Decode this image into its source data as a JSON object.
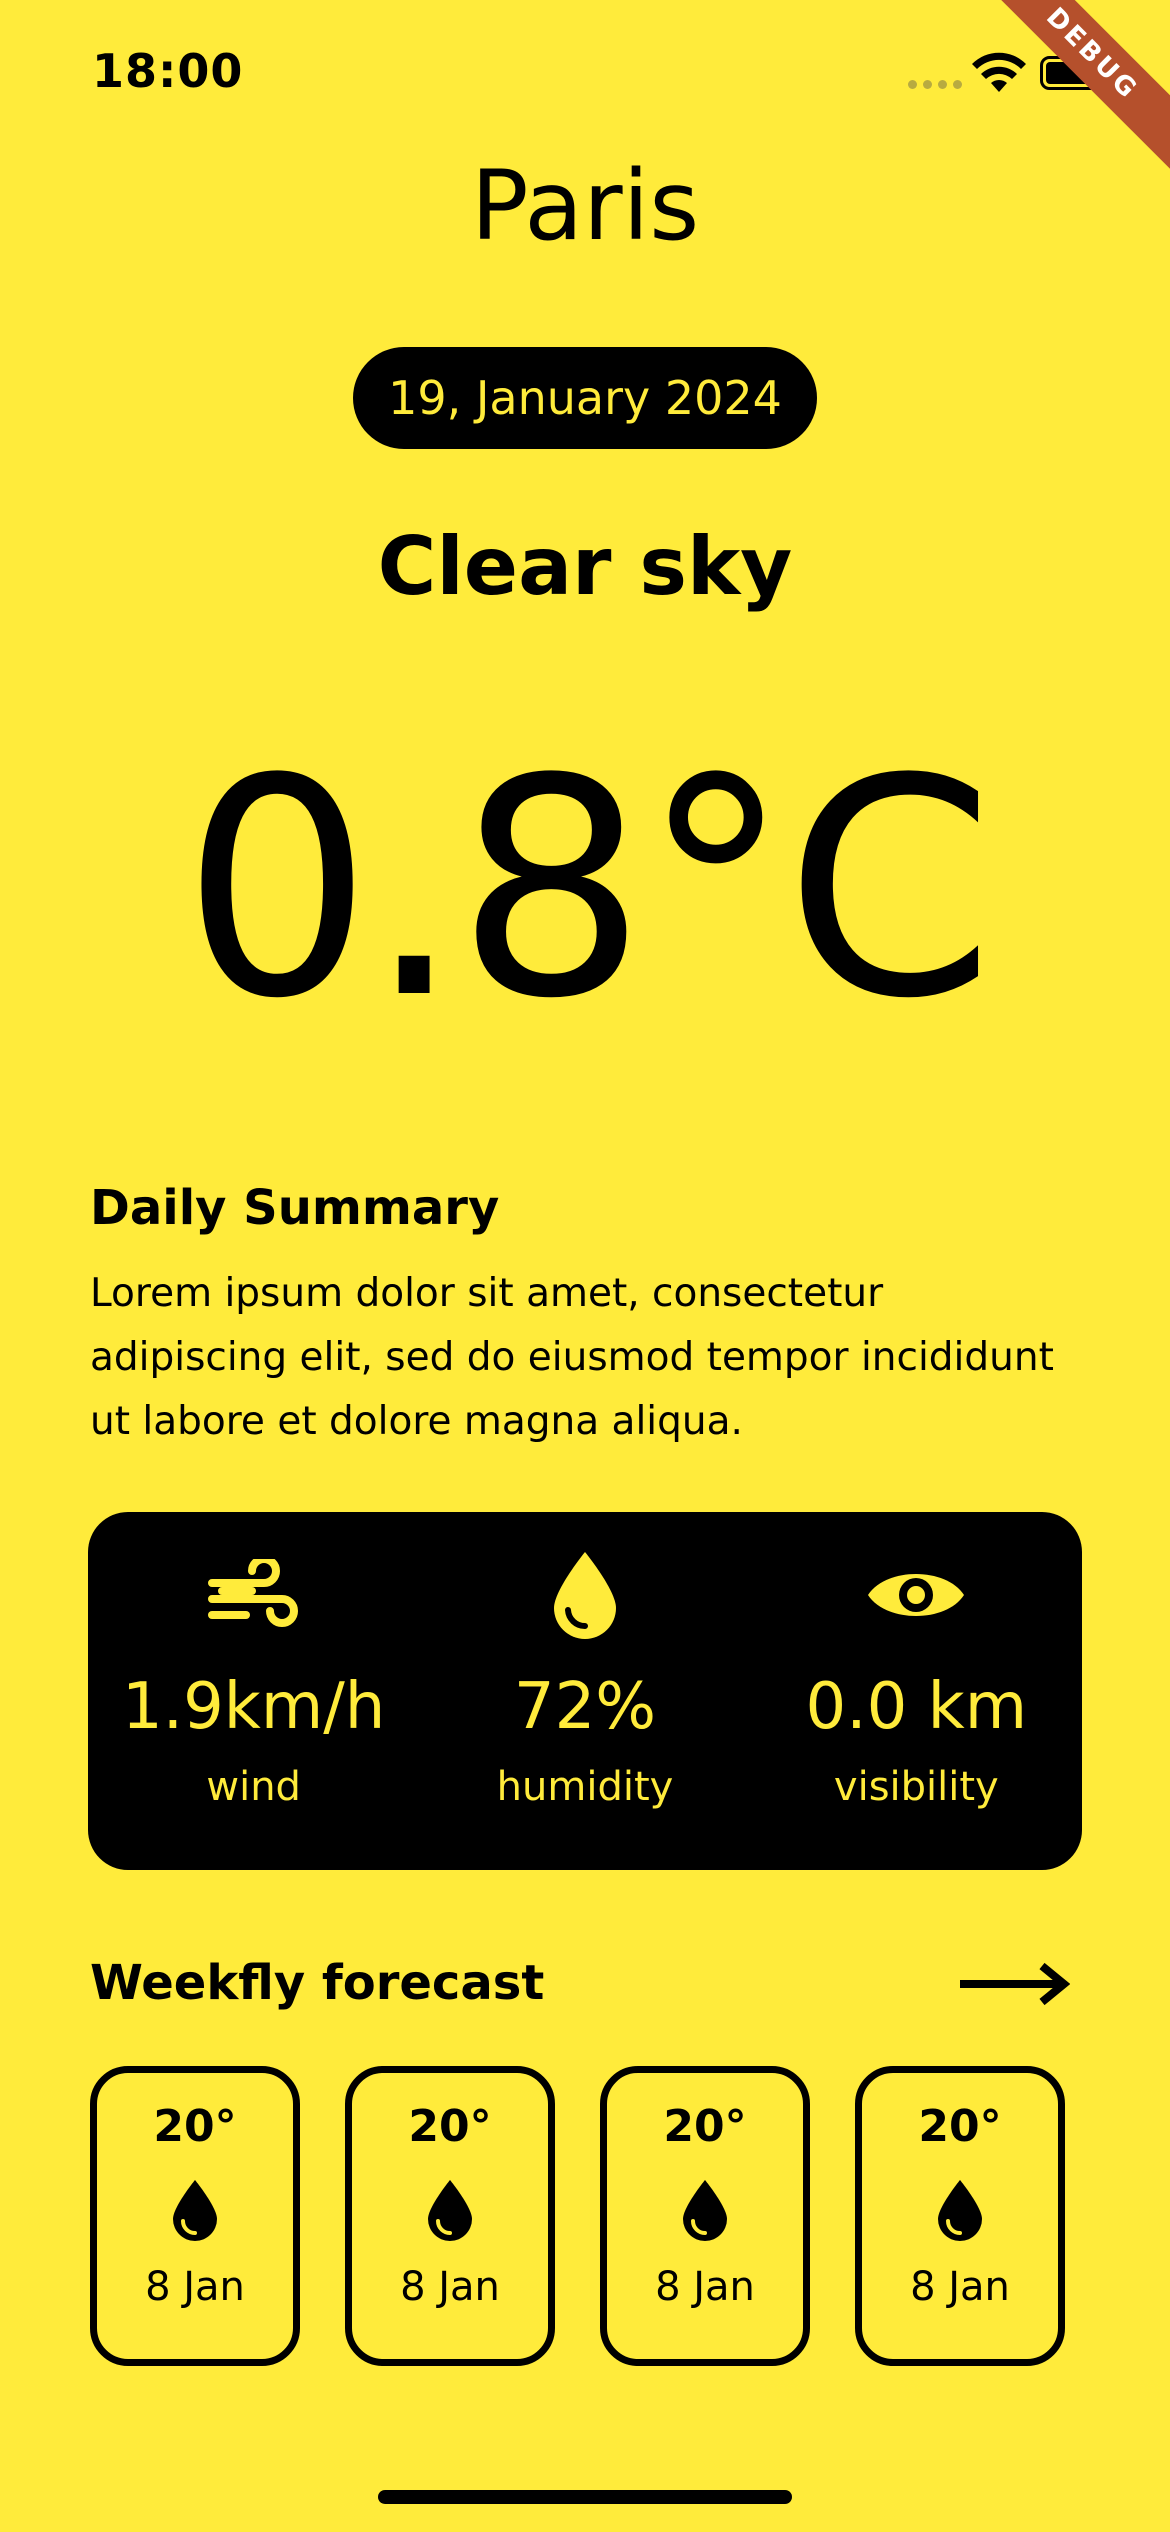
{
  "status_bar": {
    "time": "18:00",
    "debug_label": "DEBUG"
  },
  "header": {
    "city": "Paris",
    "date": "19, January 2024",
    "condition": "Clear sky"
  },
  "current": {
    "temperature": "0.8°C"
  },
  "summary": {
    "title": "Daily Summary",
    "text": "Lorem ipsum dolor sit amet, consectetur adipiscing elit, sed do eiusmod tempor incididunt ut labore et dolore magna aliqua."
  },
  "stats": [
    {
      "icon": "wind-icon",
      "value": "1.9km/h",
      "label": "wind"
    },
    {
      "icon": "humidity-icon",
      "value": "72%",
      "label": "humidity"
    },
    {
      "icon": "eye-icon",
      "value": "0.0 km",
      "label": "visibility"
    }
  ],
  "weekly": {
    "title": "Weekfly forecast",
    "items": [
      {
        "temp": "20°",
        "icon": "water-drop-icon",
        "date": "8 Jan"
      },
      {
        "temp": "20°",
        "icon": "water-drop-icon",
        "date": "8 Jan"
      },
      {
        "temp": "20°",
        "icon": "water-drop-icon",
        "date": "8 Jan"
      },
      {
        "temp": "20°",
        "icon": "water-drop-icon",
        "date": "8 Jan"
      }
    ]
  },
  "colors": {
    "background": "#FFEB3B",
    "card": "#000000",
    "accent_text": "#FFEB3B",
    "debug_banner": "#B5502C"
  }
}
